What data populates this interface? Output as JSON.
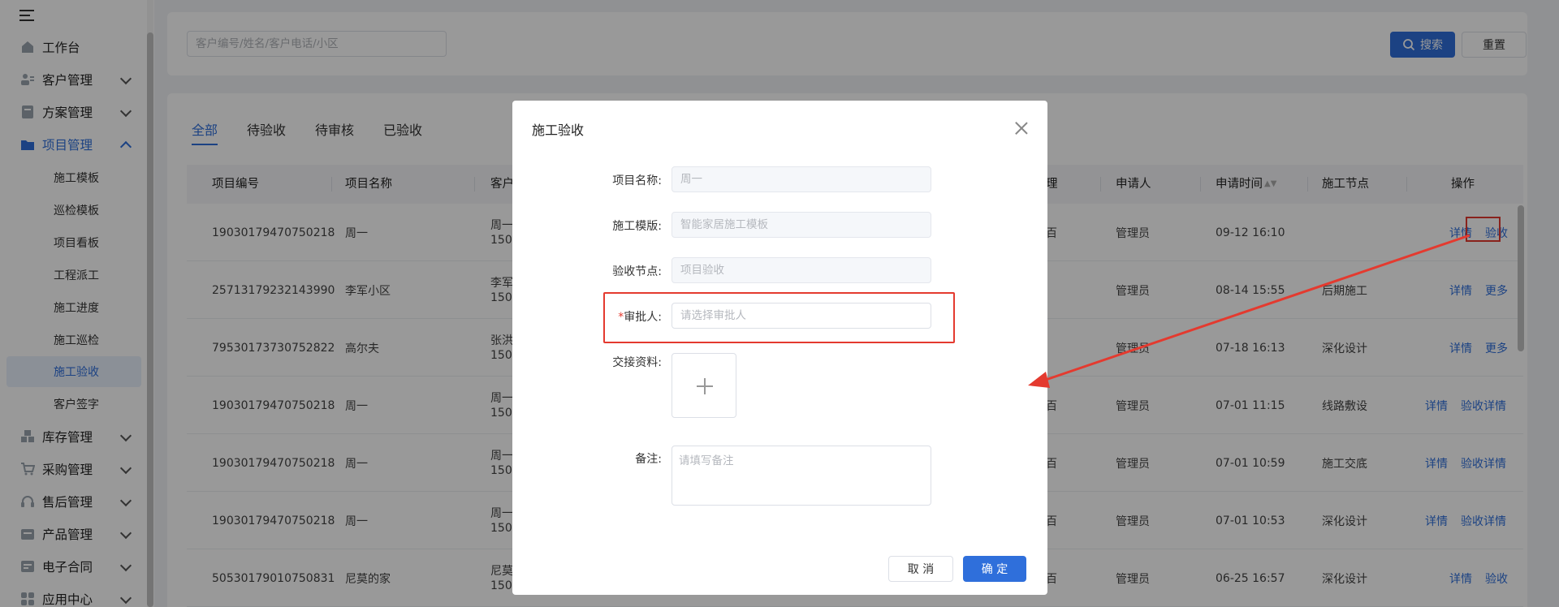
{
  "sidebar": {
    "items": [
      {
        "label": "工作台",
        "icon": "home-icon",
        "has_children": false
      },
      {
        "label": "客户管理",
        "icon": "users-icon",
        "has_children": true
      },
      {
        "label": "方案管理",
        "icon": "document-icon",
        "has_children": true
      },
      {
        "label": "项目管理",
        "icon": "folder-icon",
        "has_children": true,
        "expanded": true
      },
      {
        "label": "库存管理",
        "icon": "boxes-icon",
        "has_children": true
      },
      {
        "label": "采购管理",
        "icon": "cart-icon",
        "has_children": true
      },
      {
        "label": "售后管理",
        "icon": "headset-icon",
        "has_children": true
      },
      {
        "label": "产品管理",
        "icon": "product-icon",
        "has_children": true
      },
      {
        "label": "电子合同",
        "icon": "contract-icon",
        "has_children": true
      },
      {
        "label": "应用中心",
        "icon": "apps-icon",
        "has_children": true
      }
    ],
    "project_sub_items": [
      "施工模板",
      "巡检模板",
      "项目看板",
      "工程派工",
      "施工进度",
      "施工巡检",
      "施工验收",
      "客户签字"
    ],
    "selected_sub_item": "施工验收"
  },
  "search": {
    "placeholder": "客户编号/姓名/客户电话/小区",
    "search_label": "搜索",
    "reset_label": "重置"
  },
  "tabs": [
    "全部",
    "待验收",
    "待审核",
    "已验收"
  ],
  "active_tab": "全部",
  "table": {
    "headers": {
      "project_no": "项目编号",
      "project_name": "项目名称",
      "customer": "客户",
      "manager": "理",
      "applicant": "申请人",
      "apply_time": "申请时间",
      "node": "施工节点",
      "actions": "操作"
    },
    "rows": [
      {
        "project_no": "19030179470750218",
        "project_name": "周一",
        "customer_1": "周一",
        "customer_2": "150",
        "manager": "百",
        "applicant": "管理员",
        "apply_time": "09-12 16:10",
        "node": "",
        "action_1": "详情",
        "action_2": "验收"
      },
      {
        "project_no": "25713179232143990",
        "project_name": "李军小区",
        "customer_1": "李军",
        "customer_2": "150",
        "manager": "",
        "applicant": "管理员",
        "apply_time": "08-14 15:55",
        "node": "后期施工",
        "action_1": "详情",
        "action_2": "更多"
      },
      {
        "project_no": "79530173730752822",
        "project_name": "高尔夫",
        "customer_1": "张洪",
        "customer_2": "150",
        "manager": "",
        "applicant": "管理员",
        "apply_time": "07-18 16:13",
        "node": "深化设计",
        "action_1": "详情",
        "action_2": "更多"
      },
      {
        "project_no": "19030179470750218",
        "project_name": "周一",
        "customer_1": "周一",
        "customer_2": "150",
        "manager": "百",
        "applicant": "管理员",
        "apply_time": "07-01 11:15",
        "node": "线路敷设",
        "action_1": "详情",
        "action_2": "验收详情"
      },
      {
        "project_no": "19030179470750218",
        "project_name": "周一",
        "customer_1": "周一",
        "customer_2": "150",
        "manager": "百",
        "applicant": "管理员",
        "apply_time": "07-01 10:59",
        "node": "施工交底",
        "action_1": "详情",
        "action_2": "验收详情"
      },
      {
        "project_no": "19030179470750218",
        "project_name": "周一",
        "customer_1": "周一",
        "customer_2": "150",
        "manager": "百",
        "applicant": "管理员",
        "apply_time": "07-01 10:53",
        "node": "深化设计",
        "action_1": "详情",
        "action_2": "验收详情"
      },
      {
        "project_no": "50530179010750831",
        "project_name": "尼莫的家",
        "customer_1": "尼莫",
        "customer_2": "150",
        "manager": "百",
        "applicant": "管理员",
        "apply_time": "06-25 16:57",
        "node": "深化设计",
        "action_1": "详情",
        "action_2": "验收"
      }
    ]
  },
  "modal": {
    "title": "施工验收",
    "fields": {
      "project_name_label": "项目名称:",
      "project_name_value": "周一",
      "template_label": "施工模版:",
      "template_value": "智能家居施工模板",
      "node_label": "验收节点:",
      "node_value": "项目验收",
      "approver_required": "*",
      "approver_label": "审批人:",
      "approver_placeholder": "请选择审批人",
      "attachment_label": "交接资料:",
      "remark_label": "备注:",
      "remark_placeholder": "请填写备注"
    },
    "cancel_label": "取 消",
    "ok_label": "确 定"
  },
  "colors": {
    "primary": "#2f6fdb",
    "annotation": "#e43a2f"
  }
}
